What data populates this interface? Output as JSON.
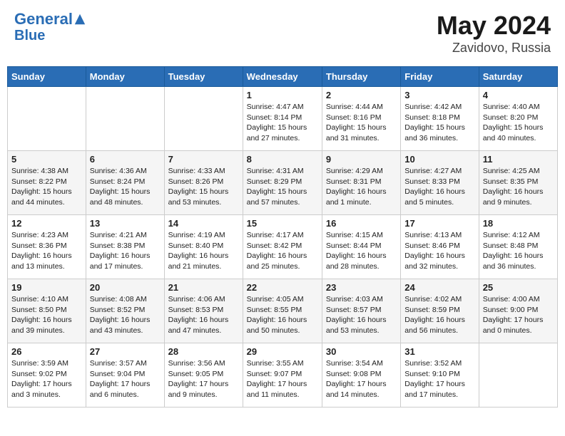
{
  "header": {
    "logo_line1": "General",
    "logo_line2": "Blue",
    "month": "May 2024",
    "location": "Zavidovo, Russia"
  },
  "weekdays": [
    "Sunday",
    "Monday",
    "Tuesday",
    "Wednesday",
    "Thursday",
    "Friday",
    "Saturday"
  ],
  "weeks": [
    [
      {
        "day": "",
        "content": ""
      },
      {
        "day": "",
        "content": ""
      },
      {
        "day": "",
        "content": ""
      },
      {
        "day": "1",
        "content": "Sunrise: 4:47 AM\nSunset: 8:14 PM\nDaylight: 15 hours\nand 27 minutes."
      },
      {
        "day": "2",
        "content": "Sunrise: 4:44 AM\nSunset: 8:16 PM\nDaylight: 15 hours\nand 31 minutes."
      },
      {
        "day": "3",
        "content": "Sunrise: 4:42 AM\nSunset: 8:18 PM\nDaylight: 15 hours\nand 36 minutes."
      },
      {
        "day": "4",
        "content": "Sunrise: 4:40 AM\nSunset: 8:20 PM\nDaylight: 15 hours\nand 40 minutes."
      }
    ],
    [
      {
        "day": "5",
        "content": "Sunrise: 4:38 AM\nSunset: 8:22 PM\nDaylight: 15 hours\nand 44 minutes."
      },
      {
        "day": "6",
        "content": "Sunrise: 4:36 AM\nSunset: 8:24 PM\nDaylight: 15 hours\nand 48 minutes."
      },
      {
        "day": "7",
        "content": "Sunrise: 4:33 AM\nSunset: 8:26 PM\nDaylight: 15 hours\nand 53 minutes."
      },
      {
        "day": "8",
        "content": "Sunrise: 4:31 AM\nSunset: 8:29 PM\nDaylight: 15 hours\nand 57 minutes."
      },
      {
        "day": "9",
        "content": "Sunrise: 4:29 AM\nSunset: 8:31 PM\nDaylight: 16 hours\nand 1 minute."
      },
      {
        "day": "10",
        "content": "Sunrise: 4:27 AM\nSunset: 8:33 PM\nDaylight: 16 hours\nand 5 minutes."
      },
      {
        "day": "11",
        "content": "Sunrise: 4:25 AM\nSunset: 8:35 PM\nDaylight: 16 hours\nand 9 minutes."
      }
    ],
    [
      {
        "day": "12",
        "content": "Sunrise: 4:23 AM\nSunset: 8:36 PM\nDaylight: 16 hours\nand 13 minutes."
      },
      {
        "day": "13",
        "content": "Sunrise: 4:21 AM\nSunset: 8:38 PM\nDaylight: 16 hours\nand 17 minutes."
      },
      {
        "day": "14",
        "content": "Sunrise: 4:19 AM\nSunset: 8:40 PM\nDaylight: 16 hours\nand 21 minutes."
      },
      {
        "day": "15",
        "content": "Sunrise: 4:17 AM\nSunset: 8:42 PM\nDaylight: 16 hours\nand 25 minutes."
      },
      {
        "day": "16",
        "content": "Sunrise: 4:15 AM\nSunset: 8:44 PM\nDaylight: 16 hours\nand 28 minutes."
      },
      {
        "day": "17",
        "content": "Sunrise: 4:13 AM\nSunset: 8:46 PM\nDaylight: 16 hours\nand 32 minutes."
      },
      {
        "day": "18",
        "content": "Sunrise: 4:12 AM\nSunset: 8:48 PM\nDaylight: 16 hours\nand 36 minutes."
      }
    ],
    [
      {
        "day": "19",
        "content": "Sunrise: 4:10 AM\nSunset: 8:50 PM\nDaylight: 16 hours\nand 39 minutes."
      },
      {
        "day": "20",
        "content": "Sunrise: 4:08 AM\nSunset: 8:52 PM\nDaylight: 16 hours\nand 43 minutes."
      },
      {
        "day": "21",
        "content": "Sunrise: 4:06 AM\nSunset: 8:53 PM\nDaylight: 16 hours\nand 47 minutes."
      },
      {
        "day": "22",
        "content": "Sunrise: 4:05 AM\nSunset: 8:55 PM\nDaylight: 16 hours\nand 50 minutes."
      },
      {
        "day": "23",
        "content": "Sunrise: 4:03 AM\nSunset: 8:57 PM\nDaylight: 16 hours\nand 53 minutes."
      },
      {
        "day": "24",
        "content": "Sunrise: 4:02 AM\nSunset: 8:59 PM\nDaylight: 16 hours\nand 56 minutes."
      },
      {
        "day": "25",
        "content": "Sunrise: 4:00 AM\nSunset: 9:00 PM\nDaylight: 17 hours\nand 0 minutes."
      }
    ],
    [
      {
        "day": "26",
        "content": "Sunrise: 3:59 AM\nSunset: 9:02 PM\nDaylight: 17 hours\nand 3 minutes."
      },
      {
        "day": "27",
        "content": "Sunrise: 3:57 AM\nSunset: 9:04 PM\nDaylight: 17 hours\nand 6 minutes."
      },
      {
        "day": "28",
        "content": "Sunrise: 3:56 AM\nSunset: 9:05 PM\nDaylight: 17 hours\nand 9 minutes."
      },
      {
        "day": "29",
        "content": "Sunrise: 3:55 AM\nSunset: 9:07 PM\nDaylight: 17 hours\nand 11 minutes."
      },
      {
        "day": "30",
        "content": "Sunrise: 3:54 AM\nSunset: 9:08 PM\nDaylight: 17 hours\nand 14 minutes."
      },
      {
        "day": "31",
        "content": "Sunrise: 3:52 AM\nSunset: 9:10 PM\nDaylight: 17 hours\nand 17 minutes."
      },
      {
        "day": "",
        "content": ""
      }
    ]
  ]
}
